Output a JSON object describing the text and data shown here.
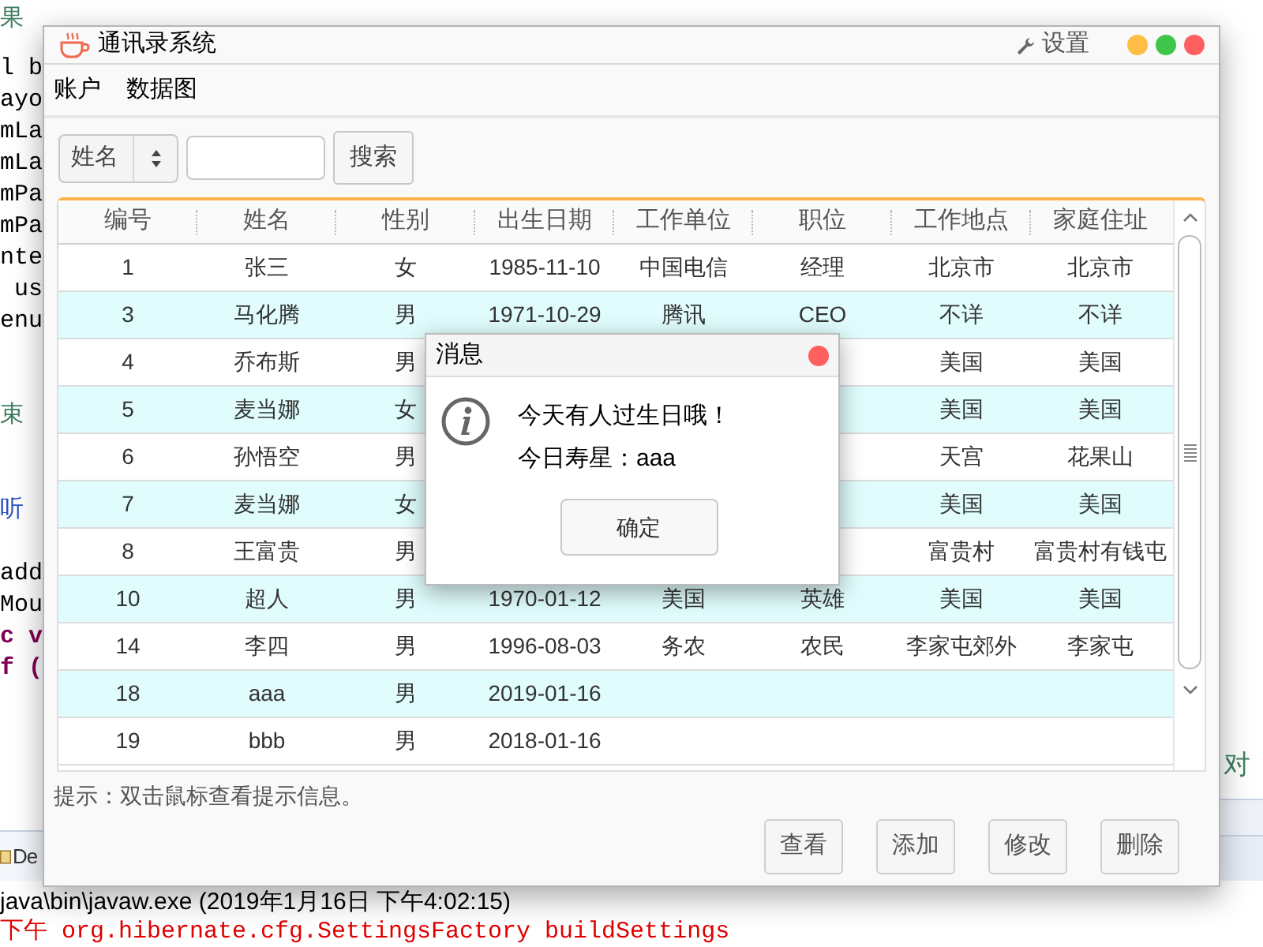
{
  "ide": {
    "header_fragment": {
      "kind": "comment",
      "text": "果"
    },
    "code_lines": [
      {
        "kind": "code",
        "text": "l b"
      },
      {
        "kind": "code",
        "text": "ayo"
      },
      {
        "kind": "code",
        "text": "mLa"
      },
      {
        "kind": "code",
        "text": "mLa"
      },
      {
        "kind": "code",
        "text": "mPa"
      },
      {
        "kind": "code",
        "text": "mPa"
      },
      {
        "kind": "code",
        "text": "nte"
      },
      {
        "kind": "code",
        "text": " us"
      },
      {
        "kind": "code",
        "text": "enu"
      },
      {
        "kind": "blank"
      },
      {
        "kind": "blank"
      },
      {
        "kind": "comment",
        "text": "束"
      },
      {
        "kind": "blank"
      },
      {
        "kind": "blank"
      },
      {
        "kind": "link",
        "text": "听"
      },
      {
        "kind": "blank"
      },
      {
        "kind": "code",
        "text": "add"
      },
      {
        "kind": "code",
        "text": "Mou"
      },
      {
        "kind": "keyword",
        "text": "c v"
      },
      {
        "kind": "keyword",
        "text": "f ("
      }
    ],
    "right_fragment": {
      "kind": "comment",
      "text": "对"
    },
    "bottom_tabs": [
      {
        "label": "De"
      }
    ],
    "console_lines": [
      {
        "kind": "info",
        "text": "java\\bin\\javaw.exe (2019年1月16日 下午4:02:15)"
      },
      {
        "kind": "error",
        "text": "下午 org.hibernate.cfg.SettingsFactory buildSettings"
      }
    ]
  },
  "window": {
    "title": "通讯录系统",
    "settings_label": "设置",
    "menu": [
      "账户",
      "数据图"
    ],
    "search": {
      "field_select": "姓名",
      "button": "搜索"
    },
    "table": {
      "columns": [
        "编号",
        "姓名",
        "性别",
        "出生日期",
        "工作单位",
        "职位",
        "工作地点",
        "家庭住址"
      ],
      "rows": [
        [
          "1",
          "张三",
          "女",
          "1985-11-10",
          "中国电信",
          "经理",
          "北京市",
          "北京市"
        ],
        [
          "3",
          "马化腾",
          "男",
          "1971-10-29",
          "腾讯",
          "CEO",
          "不详",
          "不详"
        ],
        [
          "4",
          "乔布斯",
          "男",
          null,
          null,
          null,
          "美国",
          "美国"
        ],
        [
          "5",
          "麦当娜",
          "女",
          null,
          null,
          null,
          "美国",
          "美国"
        ],
        [
          "6",
          "孙悟空",
          "男",
          null,
          null,
          null,
          "天宫",
          "花果山"
        ],
        [
          "7",
          "麦当娜",
          "女",
          null,
          null,
          null,
          "美国",
          "美国"
        ],
        [
          "8",
          "王富贵",
          "男",
          null,
          null,
          null,
          "富贵村",
          "富贵村有钱屯"
        ],
        [
          "10",
          "超人",
          "男",
          "1970-01-12",
          "美国",
          "英雄",
          "美国",
          "美国"
        ],
        [
          "14",
          "李四",
          "男",
          "1996-08-03",
          "务农",
          "农民",
          "李家屯郊外",
          "李家屯"
        ],
        [
          "18",
          "aaa",
          "男",
          "2019-01-16",
          null,
          null,
          null,
          null
        ],
        [
          "19",
          "bbb",
          "男",
          "2018-01-16",
          null,
          null,
          null,
          null
        ]
      ]
    },
    "hint": "提示：双击鼠标查看提示信息。",
    "buttons": [
      "查看",
      "添加",
      "修改",
      "删除"
    ]
  },
  "dialog": {
    "title": "消息",
    "lines": [
      "今天有人过生日哦！",
      "今日寿星：aaa"
    ],
    "button": "确定"
  }
}
